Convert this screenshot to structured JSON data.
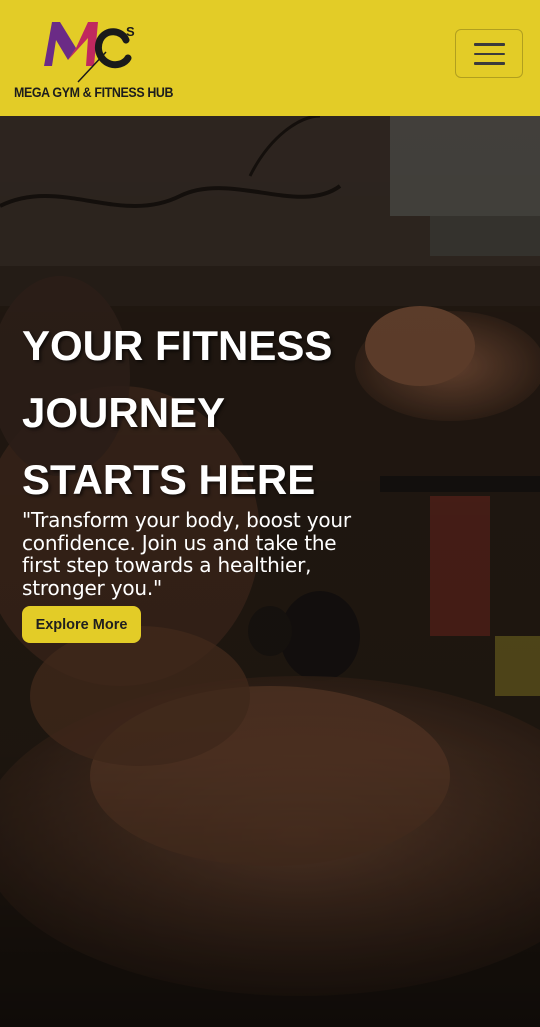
{
  "brand": {
    "name": "MEGA GYM & FITNESS HUB",
    "logo_letters": [
      "M",
      "C",
      "S"
    ],
    "logo_colors": {
      "m_left": "#6b2b86",
      "m_right": "#c0285e",
      "stroke": "#1a1a1a"
    }
  },
  "nav": {
    "toggle_icon": "hamburger-menu-icon",
    "background": "#e3cc27"
  },
  "hero": {
    "title_lines": [
      "YOUR FITNESS",
      "JOURNEY",
      "STARTS HERE"
    ],
    "quote": "\"Transform your body, boost your confidence. Join us and take the first step towards a healthier, stronger you.\"",
    "cta_label": "Explore More",
    "cta_color": "#e3cc27"
  }
}
